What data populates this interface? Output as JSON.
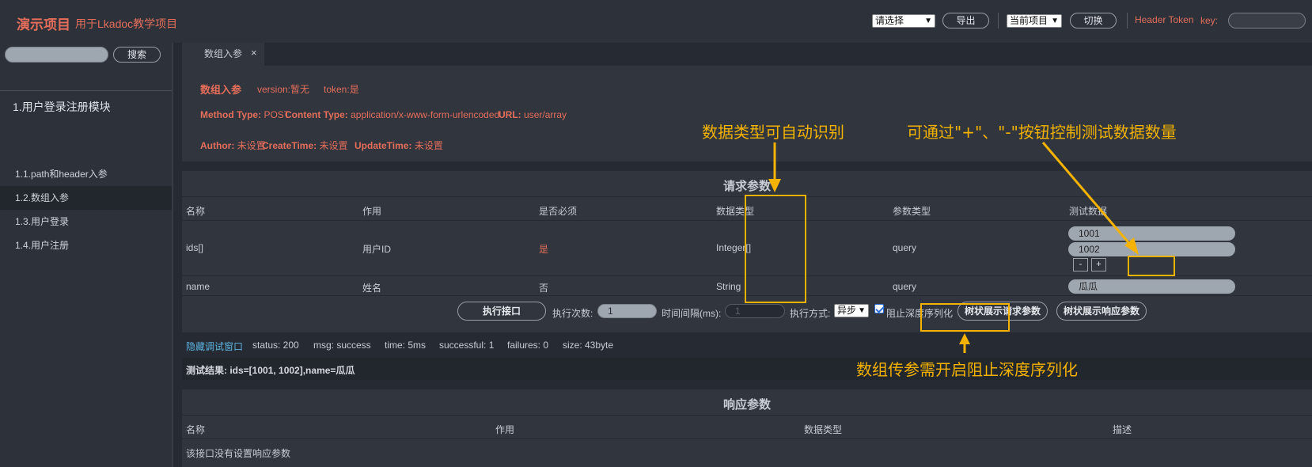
{
  "header": {
    "brand": "演示项目",
    "brand_subtitle": "用于Lkadoc教学项目",
    "env_select": "请选择",
    "export_label": "导出",
    "project_select": "当前项目",
    "switch_label": "切换",
    "header_token_label": "Header Token",
    "key_label": "key:"
  },
  "sidebar": {
    "search_label": "搜索",
    "module": "1.用户登录注册模块",
    "items": [
      {
        "label": "1.1.path和header入参"
      },
      {
        "label": "1.2.数组入参"
      },
      {
        "label": "1.3.用户登录"
      },
      {
        "label": "1.4.用户注册"
      }
    ]
  },
  "tab": {
    "label": "数组入参",
    "close": "×"
  },
  "info": {
    "title": "数组入参",
    "version_label": "version:",
    "version_value": "暂无",
    "token_label": "token:",
    "token_value": "是",
    "method_label": "Method Type:",
    "method_value": "POST",
    "content_label": "Content Type:",
    "content_value": "application/x-www-form-urlencoded",
    "url_label": "URL:",
    "url_value": "user/array",
    "author_label": "Author:",
    "author_value": "未设置",
    "create_label": "CreateTime:",
    "create_value": "未设置",
    "update_label": "UpdateTime:",
    "update_value": "未设置"
  },
  "request": {
    "title": "请求参数",
    "columns": [
      "名称",
      "作用",
      "是否必须",
      "数据类型",
      "参数类型",
      "测试数据"
    ],
    "rows": [
      {
        "name": "ids[]",
        "desc": "用户ID",
        "required": "是",
        "type": "Integer[]",
        "param": "query",
        "values": [
          "1001",
          "1002"
        ]
      },
      {
        "name": "name",
        "desc": "姓名",
        "required": "否",
        "type": "String",
        "param": "query",
        "values": [
          "瓜瓜"
        ]
      }
    ],
    "minus": "-",
    "plus": "+",
    "execute_label": "执行接口",
    "count_label": "执行次数:",
    "count_value": "1",
    "interval_label": "时间间隔(ms):",
    "interval_value": "1",
    "mode_label": "执行方式:",
    "mode_value": "异步",
    "block_label": "阻止深度序列化",
    "tree_req_label": "树状展示请求参数",
    "tree_resp_label": "树状展示响应参数"
  },
  "status": {
    "hide_label": "隐藏调试窗口",
    "status": "status: 200",
    "msg": "msg: success",
    "time": "time: 5ms",
    "successful": "successful: 1",
    "failures": "failures: 0",
    "size": "size: 43byte",
    "result": "测试结果: ids=[1001, 1002],name=瓜瓜"
  },
  "response": {
    "title": "响应参数",
    "columns": [
      "名称",
      "作用",
      "数据类型",
      "描述"
    ],
    "empty": "该接口没有设置响应参数"
  },
  "annotations": {
    "type_note": "数据类型可自动识别",
    "count_note": "可通过\"+\"、\"-\"按钮控制测试数据数量",
    "serialize_note": "数组传参需开启阻止深度序列化",
    "color": "#f5b300"
  }
}
